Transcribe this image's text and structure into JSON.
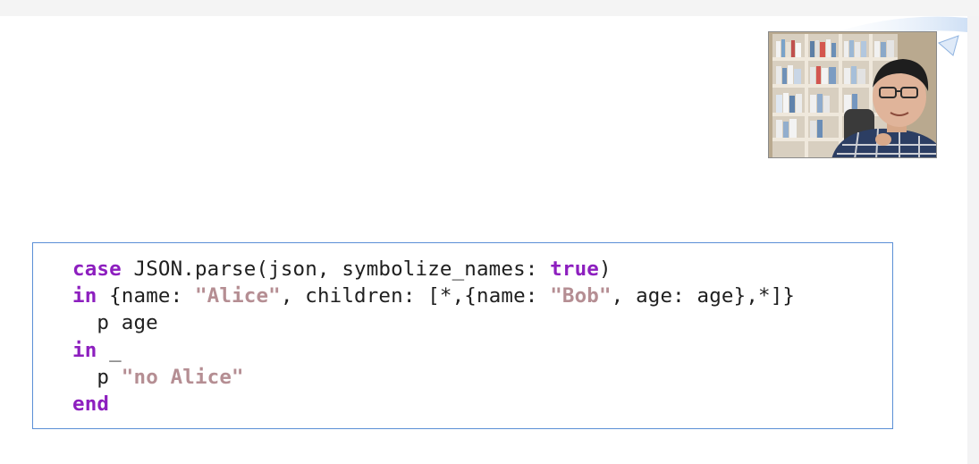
{
  "slide": {
    "accent_color": "#5b8fd6",
    "keyword_color": "#8d1fbf",
    "string_color": "#b58e93"
  },
  "webcam": {
    "description_icon": "presenter-video-icon"
  },
  "code": {
    "lines": [
      [
        {
          "t": "case",
          "k": "kw"
        },
        {
          "t": " JSON.parse(json, symbolize_names: ",
          "k": "plain"
        },
        {
          "t": "true",
          "k": "kw"
        },
        {
          "t": ")",
          "k": "plain"
        }
      ],
      [
        {
          "t": "in",
          "k": "kw"
        },
        {
          "t": " {name: ",
          "k": "plain"
        },
        {
          "t": "\"Alice\"",
          "k": "str"
        },
        {
          "t": ", children: [*,{name: ",
          "k": "plain"
        },
        {
          "t": "\"Bob\"",
          "k": "str"
        },
        {
          "t": ", age: age},*]}",
          "k": "plain"
        }
      ],
      [
        {
          "t": "  p age",
          "k": "plain"
        }
      ],
      [
        {
          "t": "in",
          "k": "kw"
        },
        {
          "t": " _",
          "k": "plain"
        }
      ],
      [
        {
          "t": "  p ",
          "k": "plain"
        },
        {
          "t": "\"no Alice\"",
          "k": "str"
        }
      ],
      [
        {
          "t": "end",
          "k": "kw"
        }
      ]
    ]
  }
}
